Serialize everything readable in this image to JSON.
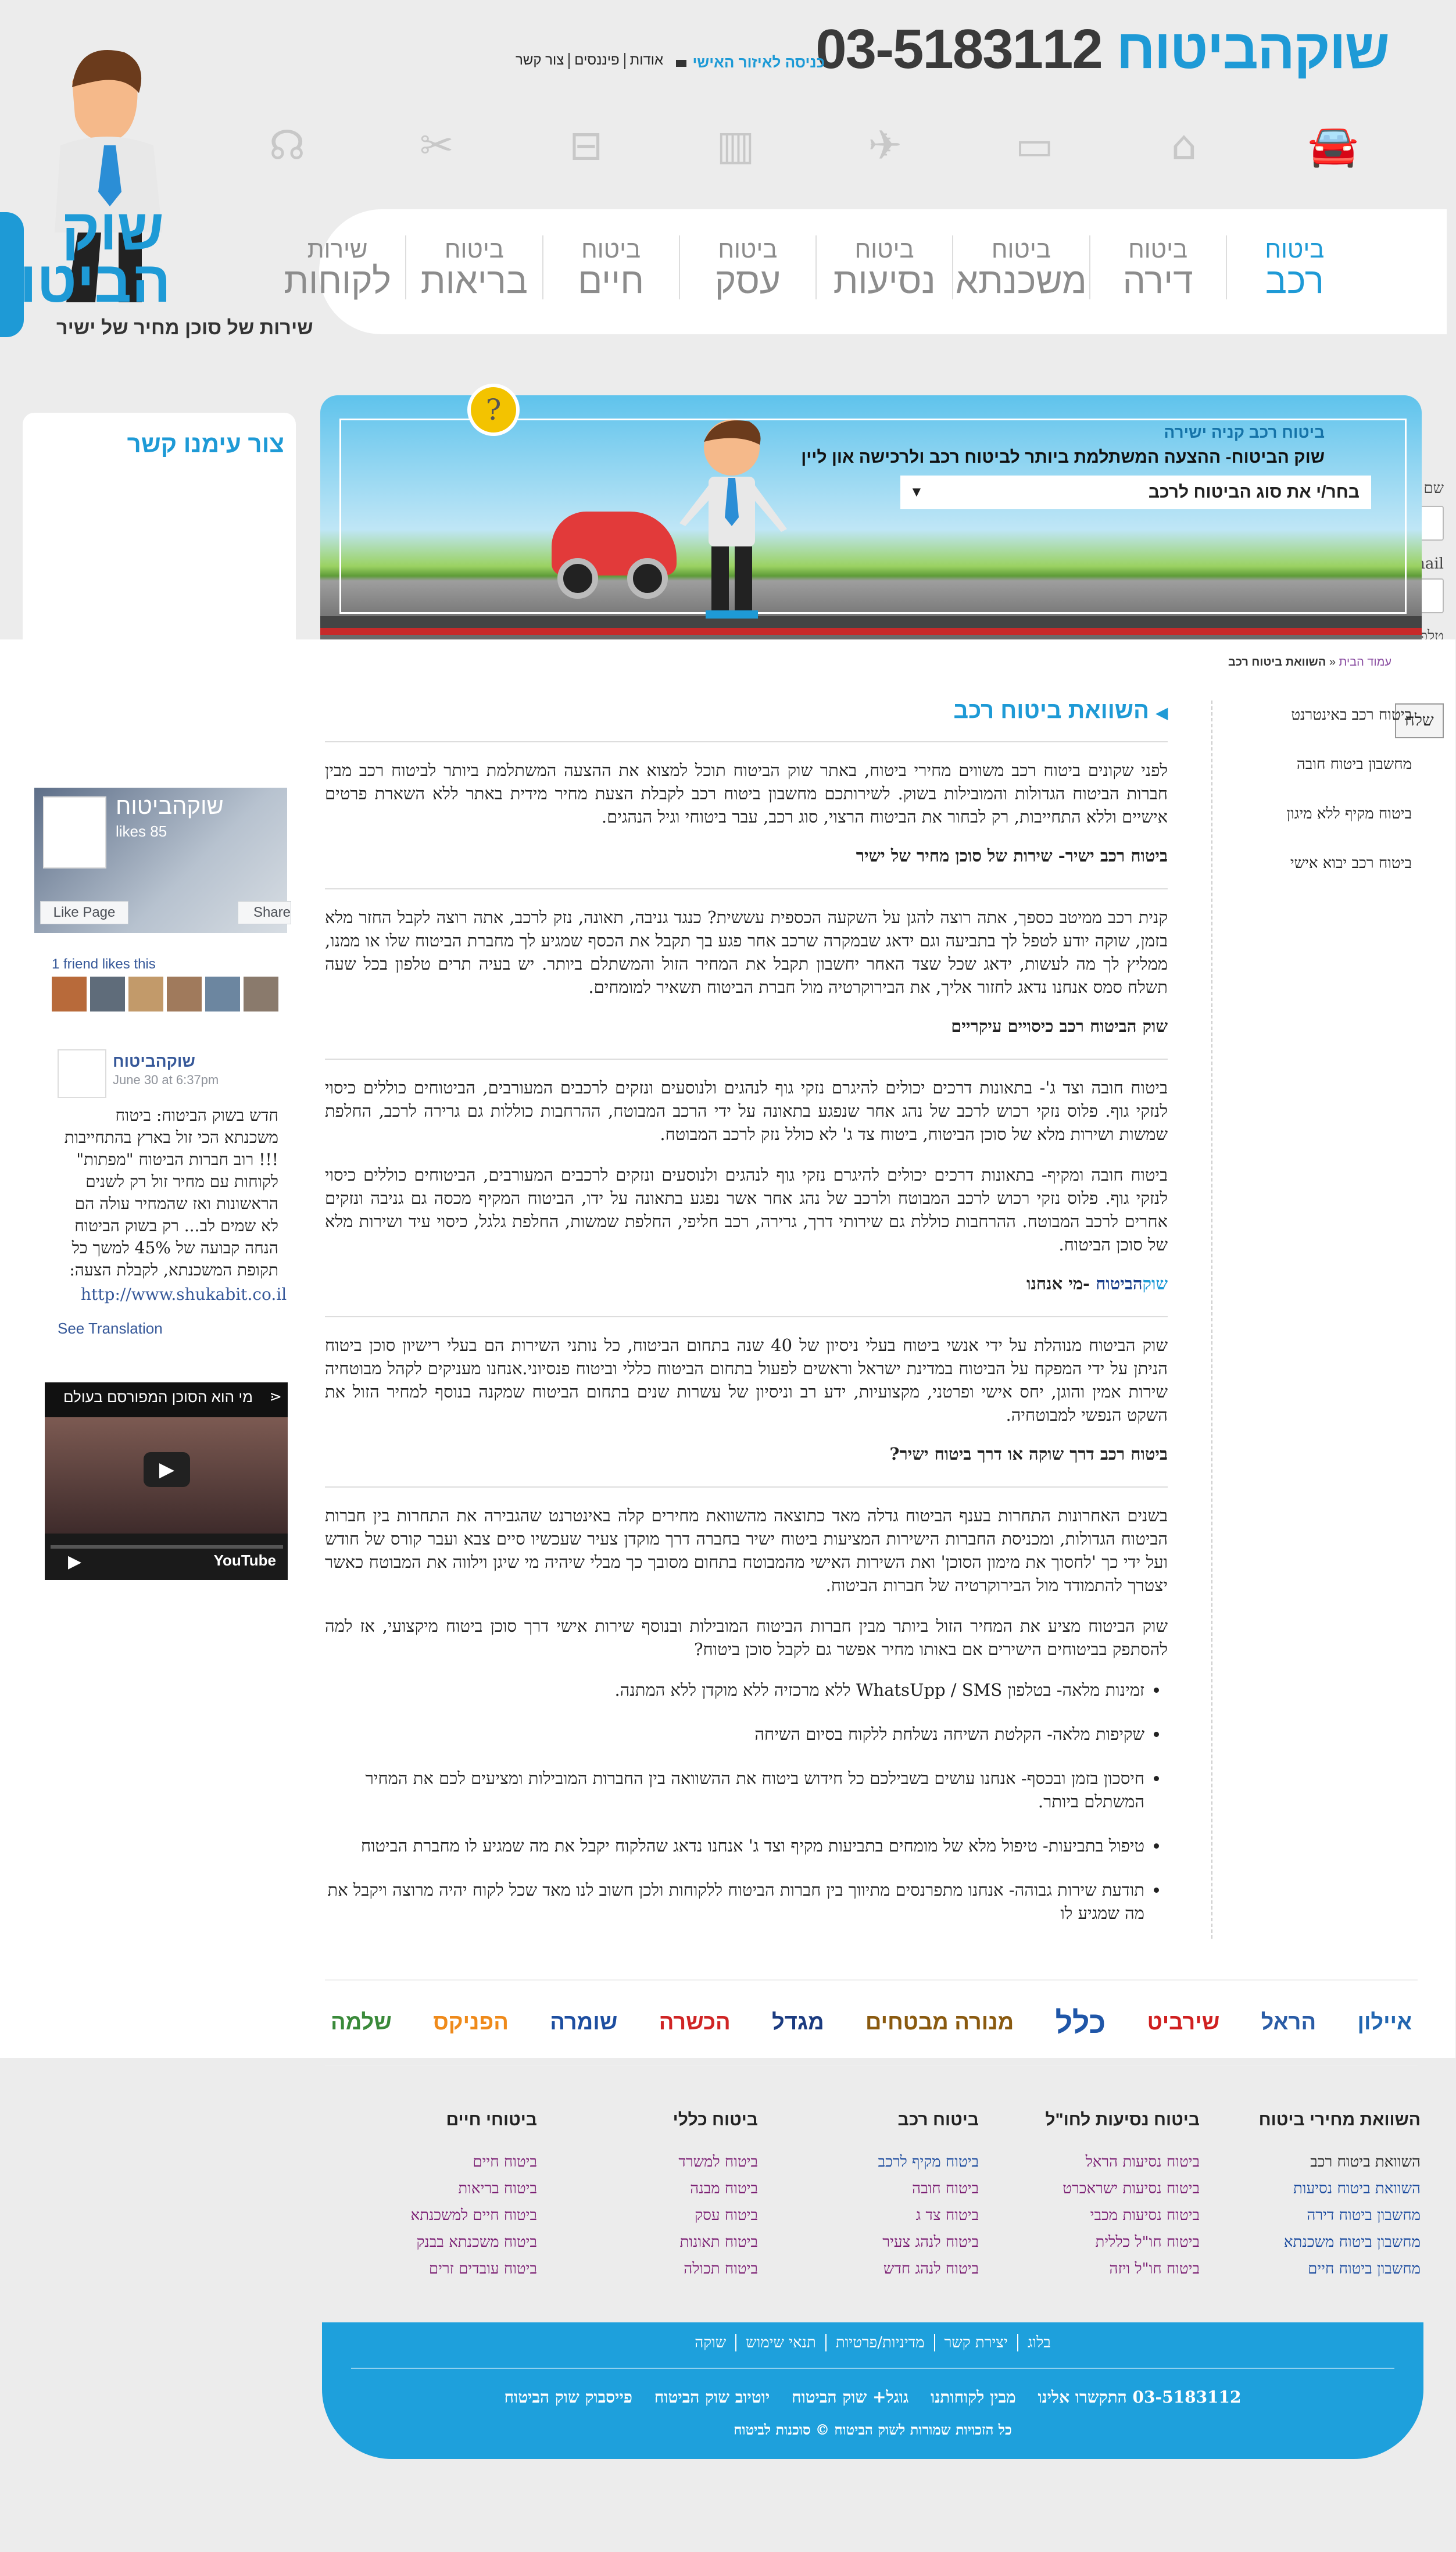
{
  "brand": {
    "name_light": "שוקהביטוח",
    "phone": "03-5183112",
    "logo_word": "שוק הביטוח",
    "tagline": "שירות של סוכן מחיר של ישיר"
  },
  "header": {
    "portal_link": "כניסה לאיזור האישי",
    "top_links": [
      "אודות",
      "פיננסים",
      "צור קשר"
    ]
  },
  "icons": [
    "car-icon",
    "house-icon",
    "tv-icon",
    "plane-icon",
    "building-icon",
    "bus-icon",
    "tools-icon",
    "headset-icon"
  ],
  "nav": [
    {
      "l1": "ביטוח",
      "l2": "רכב",
      "active": true
    },
    {
      "l1": "ביטוח",
      "l2": "דירה"
    },
    {
      "l1": "ביטוח",
      "l2": "משכנתא"
    },
    {
      "l1": "ביטוח",
      "l2": "נסיעות"
    },
    {
      "l1": "ביטוח",
      "l2": "עסק"
    },
    {
      "l1": "ביטוח",
      "l2": "חיים"
    },
    {
      "l1": "ביטוח",
      "l2": "בריאות"
    },
    {
      "l1": "שירות",
      "l2": "לקוחות"
    }
  ],
  "contact": {
    "title": "צור עימנו קשר",
    "name_label": "שם",
    "email_label": "Email",
    "phone_label": "טלפון",
    "send": "שלח"
  },
  "facebook": {
    "page_name": "שוקהביטוח",
    "likes": "85 likes",
    "like_btn": "Like Page",
    "share_btn": "Share",
    "friends": "1 friend likes this",
    "post_name": "שוקהביטוח",
    "post_date": "June 30 at 6:37pm",
    "post_text": "חדש בשוק הביטוח: ביטוח משכנתא הכי זול בארץ בהתחייבות !!! רוב חברות הביטוח \"מפתות\" לקוחות עם מחיר זול רק לשנים הראשונות ואז שהמחיר עולה הם לא שמים לב... רק בשוק הביטוח הנחה קבועה של 45% למשך כל תקופת המשכנתא, לקבלת הצעה:",
    "url": "http://www.shukabit.co.il",
    "translation": "See Translation"
  },
  "video": {
    "title": "מי הוא הסוכן המפורסם בעולם",
    "yt": "YouTube"
  },
  "hero": {
    "line1": "ביטוח רכב קניה ישירה",
    "line2": "שוק הביטוח- ההצעה המשתלמת ביותר לביטוח רכב ולרכישה און ליין",
    "select": "בחר/י את סוג הביטוח לרכב"
  },
  "breadcrumb": {
    "home": "עמוד הבית",
    "sep": "«",
    "current": "השוואת ביטוח רכב"
  },
  "side_links": [
    "ביטוח רכב באינטרנט",
    "מחשבון ביטוח חובה",
    "ביטוח מקיף ללא מיגון",
    "ביטוח רכב יבוא אישי"
  ],
  "content": {
    "title": "השוואת ביטוח רכב",
    "p1": "לפני שקונים ביטוח רכב משווים מחירי ביטוח, באתר שוק הביטוח תוכל למצוא את ההצעה המשתלמת ביותר לביטוח רכב מבין חברות הביטוח הגדולות והמובילות בשוק. לשירותכם מחשבון ביטוח רכב לקבלת הצעת מחיר מידית באתר ללא השארת פרטים אישיים וללא התחייבות, רק לבחור את הביטוח הרצוי, סוג רכב, עבר ביטוחי וגיל הנהגים.",
    "h2a": "ביטוח רכב ישיר- שירות של סוכן מחיר של ישיר",
    "p2": "קנית רכב ממיטב כספך, אתה רוצה להגן על השקעה הכספית עששית? כנגד גניבה, תאונה, נזק לרכב, אתה רוצה לקבל החזר מלא בזמן, שוקה יודע לטפל לך בתביעה וגם ידאג שבמקרה שרכב אחר פגע בך תקבל את הכסף שמגיע לך מחברת הביטוח שלו או ממנו, ממליץ לך מה לעשות, ידאג שכל שצד האחר יחשבון תקבל את המחיר הזול והמשתלם ביותר. יש בעיה תרים טלפון בכל שעה תשלח סמס אנחנו נדאג לחזור אליך, את הבירוקרטיה מול חברת הביטוח תשאיר למומחים.",
    "h2b": "שוק הביטוח רכב כיסויים עיקריים",
    "p3": "ביטוח חובה וצד ג'- בתאונות דרכים יכולים להיגרם נזקי גוף לנהגים ולנוסעים ונזקים לרכבים המעורבים, הביטוחים כוללים כיסוי לנזקי גוף. פלוס נזקי רכוש לרכב של נהג אחר שנפגע בתאונה על ידי הרכב המבוטח, ההרחבות כוללות גם גרירה לרכב, החלפת שמשות ושירות מלא של סוכן הביטוח, ביטוח צד ג' לא כולל נזק לרכב המבוטח.",
    "p4": "ביטוח חובה ומקיף- בתאונות דרכים יכולים להיגרם נזקי גוף לנהגים ולנוסעים ונזקים לרכבים המעורבים, הביטוחים כוללים כיסוי לנזקי גוף. פלוס נזקי רכוש לרכב המבוטח ולרכב של נהג אחר אשר נפגע בתאונה על ידו, הביטוח המקיף מכסה גם גניבה ונזקים אחרים לרכב המבוטח. ההרחבות כוללת גם שירותי דרך, גרירה, רכב חליפי, החלפת שמשות, החלפת גלגל, כיסוי עיד ושירות מלא של סוכן הביטוח.",
    "h2c_b1": "שוק",
    "h2c_b2": "הביטוח",
    "h2c_rest": " -מי אנחנו",
    "p5": "שוק הביטוח מנוהלת על ידי אנשי ביטוח בעלי ניסיון של 40 שנה בתחום הביטוח, כל נותני השירות הם בעלי רישיון סוכן ביטוח הניתן על ידי המפקח על הביטוח במדינת ישראל וראשים לפעול בתחום הביטוח כללי וביטוח פנסיוני.אנחנו מעניקים לקהל מבוטחיה שירות אמין והוגן, יחס אישי ופרטני, מקצועיות, ידע רב וניסיון של עשרות שנים בתחום הביטוח שמקנה בנוסף למחיר הזול את השקט הנפשי למבוטחיה.",
    "h2d": "ביטוח רכב דרך שוקה או דרך ביטוח ישיר?",
    "p6": "בשנים האחרונות התחרות בענף הביטוח גדלה מאד כתוצאה מהשוואת מחירים קלה באינטרנט שהגבירה את התחרות בין חברות הביטוח הגדולות, ומכניסת החברות הישירות המציעות ביטוח ישיר בחברה דרך מוקדן צעיר שעכשיו סיים צבא ועבר קורס של חודש ועל ידי כך 'לחסוך את מימון הסוכן' ואת השירות האישי מהמבוטח בתחום מסובך כך מבלי שיהיה מי שיגן וילווה את המבוטח כאשר יצטרך להתמודד מול הבירוקרטיה של חברות הביטוח.",
    "p7": "שוק הביטוח מציע את המחיר הזול ביותר מבין חברות הביטוח המובילות ובנוסף שירות אישי דרך סוכן ביטוח מיקצועי, אז למה להסתפק בביטוחים הישירים אם באותו מחיר אפשר גם לקבל סוכן ביטוח?",
    "bullets": [
      "זמינות מלאה- בטלפון WhatsUpp / SMS ללא מרכזיה ללא מוקדן ללא המתנה.",
      "שקיפות מלאה- הקלטת השיחה נשלחת ללקוח בסיום השיחה",
      "חיסכון בזמן ובכסף- אנחנו עושים בשבילכם כל חידוש ביטוח את ההשוואה בין החברות המובילות ומציעים לכם את המחיר המשתלם ביותר.",
      "טיפול בתביעות- טיפול מלא של מומחים בתביעות מקיף וצד ג' אנחנו נדאג שהלקוח יקבל את מה שמגיע לו מחברת הביטוח",
      "תודעת שירות גבוהה- אנחנו מתפרנסים מתיווך בין חברות הביטוח ללקוחות ולכן חשוב לנו מאד שכל לקוח יהיה מרוצה ויקבל את מה שמגיע לו"
    ]
  },
  "partners": [
    "איילון",
    "הראל",
    "שירביט",
    "כלל",
    "מנורה מבטחים",
    "מגדל",
    "הכשרה",
    "שומרה",
    "הפניקס",
    "שלמה"
  ],
  "footer_cols": [
    {
      "title": "השוואת מחירי ביטוח",
      "links": [
        "השוואת ביטוח רכב",
        "השוואת ביטוח נסיעות",
        "מחשבון ביטוח דירה",
        "מחשבון ביטוח משכנתא",
        "מחשבון ביטוח חיים"
      ]
    },
    {
      "title": "ביטוח נסיעות לחו\"ל",
      "links": [
        "ביטוח נסיעות הראל",
        "ביטוח נסיעות ישראכרט",
        "ביטוח נסיעות מכבי",
        "ביטוח חו\"ל כללית",
        "ביטוח חו\"ל ויזה"
      ]
    },
    {
      "title": "ביטוח רכב",
      "links": [
        "ביטוח מקיף לרכב",
        "ביטוח חובה",
        "ביטוח צד ג",
        "ביטוח לנהג צעיר",
        "ביטוח לנהג חדש"
      ]
    },
    {
      "title": "ביטוח כללי",
      "links": [
        "ביטוח למשרד",
        "ביטוח מבנה",
        "ביטוח עסק",
        "ביטוח תאונות",
        "ביטוח תכולה"
      ]
    },
    {
      "title": "ביטוחי חיים",
      "links": [
        "ביטוח חיים",
        "ביטוח בריאות",
        "ביטוח חיים למשכנתא",
        "ביטוח משכנתא בבנק",
        "ביטוח עובדים זרים"
      ]
    }
  ],
  "footer": {
    "top_links": [
      "בלוג",
      "יצירת קשר",
      "מדיניות/פרטיות",
      "תנאי שימוש",
      "שוקה"
    ],
    "mid_links": [
      "03-5183112 התקשרו אלינו",
      "מבין לקוחותנו",
      "גוגל+ שוק הביטוח",
      "יוטיוב שוק הביטוח",
      "פייסבוק שוק הביטוח"
    ],
    "copyright": "כל הזכויות שמורות לשוק הביטוח © סוכנות לביטוח"
  },
  "colors": {
    "accent": "#1e9ad6",
    "footer": "#1ea0dc",
    "link": "#7b1f73"
  }
}
